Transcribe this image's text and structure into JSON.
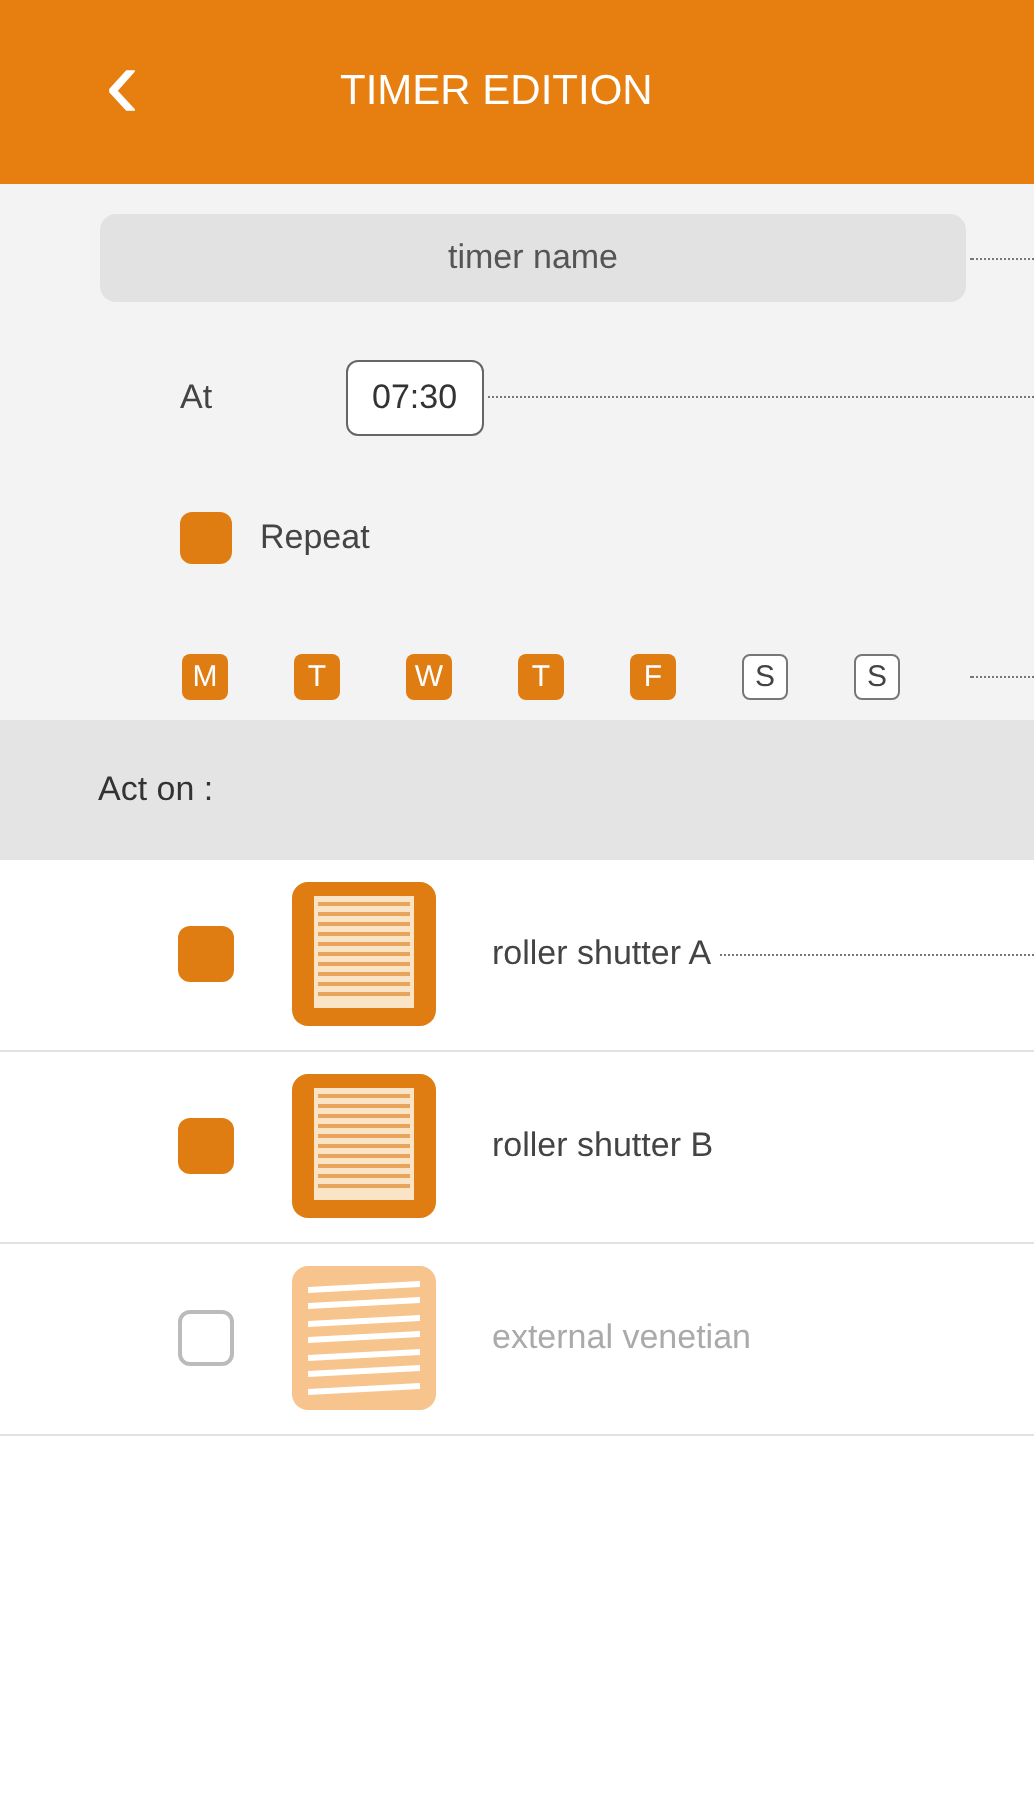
{
  "header": {
    "back_icon": "‹",
    "title": "TIMER EDITION"
  },
  "timer_name": {
    "placeholder": "timer name"
  },
  "at": {
    "label": "At",
    "value": "07:30"
  },
  "repeat": {
    "label": "Repeat",
    "checked": true
  },
  "days": [
    {
      "label": "M",
      "selected": true
    },
    {
      "label": "T",
      "selected": true
    },
    {
      "label": "W",
      "selected": true
    },
    {
      "label": "T",
      "selected": true
    },
    {
      "label": "F",
      "selected": true
    },
    {
      "label": "S",
      "selected": false
    },
    {
      "label": "S",
      "selected": false
    }
  ],
  "act_on": {
    "label": "Act on :"
  },
  "devices": [
    {
      "name": "roller shutter A",
      "kind": "roller",
      "checked": true,
      "disabled": false
    },
    {
      "name": "roller shutter B",
      "kind": "roller",
      "checked": true,
      "disabled": false
    },
    {
      "name": "external venetian",
      "kind": "venetian",
      "checked": false,
      "disabled": true
    }
  ]
}
